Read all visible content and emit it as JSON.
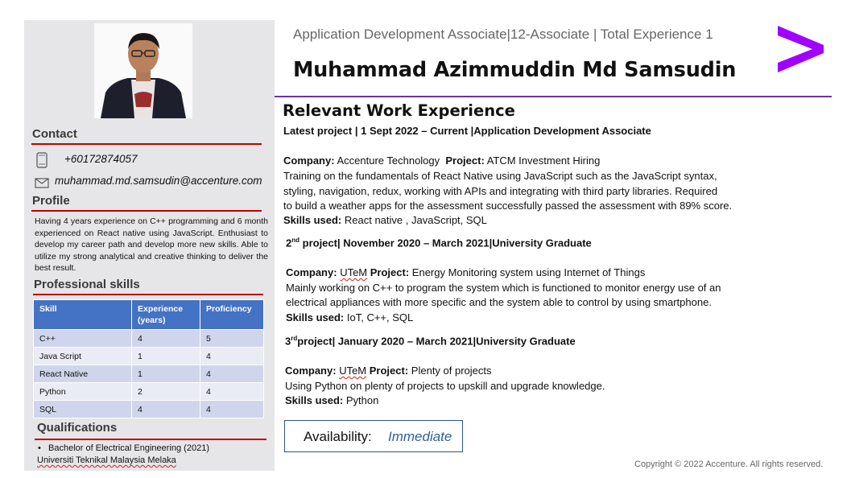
{
  "colors": {
    "accent_purple": "#a100ff",
    "rule_red": "#c00000",
    "table_header": "#4472c4",
    "availability_value": "#2e5f9e"
  },
  "sidebar": {
    "contact_title": "Contact",
    "phone": "+60172874057",
    "email": "muhammad.md.samsudin@accenture.com",
    "phone_icon": "mobile-phone-icon",
    "email_icon": "envelope-icon",
    "profile_title": "Profile",
    "profile_text": "Having 4 years experience on C++ programming and 6 month experienced on React native using JavaScript. Enthusiast to develop my career path and develop more new skills. Able to utilize my strong analytical and creative thinking to deliver the best result.",
    "skills_title": "Professional skills",
    "skills_headers": {
      "skill": "Skill",
      "experience": "Experience (years)",
      "proficiency": "Proficiency"
    },
    "skills": [
      {
        "skill": "C++",
        "experience": "4",
        "proficiency": "5"
      },
      {
        "skill": "Java Script",
        "experience": "1",
        "proficiency": "4"
      },
      {
        "skill": "React Native",
        "experience": "1",
        "proficiency": "4"
      },
      {
        "skill": "Python",
        "experience": "2",
        "proficiency": "4"
      },
      {
        "skill": "SQL",
        "experience": "4",
        "proficiency": "4"
      }
    ],
    "qualifications_title": "Qualifications",
    "qualification_degree": "Bachelor of Electrical Engineering (2021)",
    "qualification_university": "Universiti Teknikal Malaysia Melaka"
  },
  "header": {
    "subtitle": "Application Development Associate|12-Associate | Total Experience 1",
    "name": "Muhammad Azimmuddin Md Samsudin",
    "logo_icon": "accenture-greater-than-logo"
  },
  "experience": {
    "title": "Relevant Work Experience",
    "latest_heading": "Latest project | 1 Sept 2022 – Current |Application Development Associate",
    "latest": {
      "company_label": "Company:",
      "company": "Accenture Technology",
      "project_label": "Project:",
      "project": "ATCM Investment Hiring",
      "desc_lines": [
        "Training on the fundamentals of React Native using JavaScript such as the JavaScript syntax,",
        "styling, navigation, redux, working with APIs and integrating with third party libraries. Required",
        "to build a weather apps for the assessment successfully passed the assessment with 89% score."
      ],
      "skills_label": "Skills used:",
      "skills": "React native , JavaScript, SQL"
    },
    "second": {
      "ordinal_num": "2",
      "ordinal_suffix": "nd",
      "heading_rest": " project| November 2020 – March 2021|University Graduate",
      "company_label": "Company:",
      "company": "UTeM",
      "project_label": "Project:",
      "project": "Energy Monitoring system using Internet of Things",
      "desc_lines": [
        "Mainly working on C++ to program the system which is functioned to monitor energy use of an",
        "electrical appliances with more specific and the system able to control by using smartphone."
      ],
      "skills_label": "Skills used:",
      "skills": "IoT, C++, SQL"
    },
    "third": {
      "ordinal_num": "3",
      "ordinal_suffix": "rd",
      "heading_rest": "project| January 2020 – March 2021|University Graduate",
      "company_label": "Company:",
      "company": "UTeM",
      "project_label": "Project:",
      "project": "Plenty of projects",
      "desc_lines": [
        "Using Python on plenty of projects to upskill and upgrade knowledge."
      ],
      "skills_label": "Skills used:",
      "skills": "Python"
    }
  },
  "availability": {
    "label": "Availability:",
    "value": "Immediate"
  },
  "footer": {
    "copyright": "Copyright © 2022 Accenture. All rights reserved."
  }
}
